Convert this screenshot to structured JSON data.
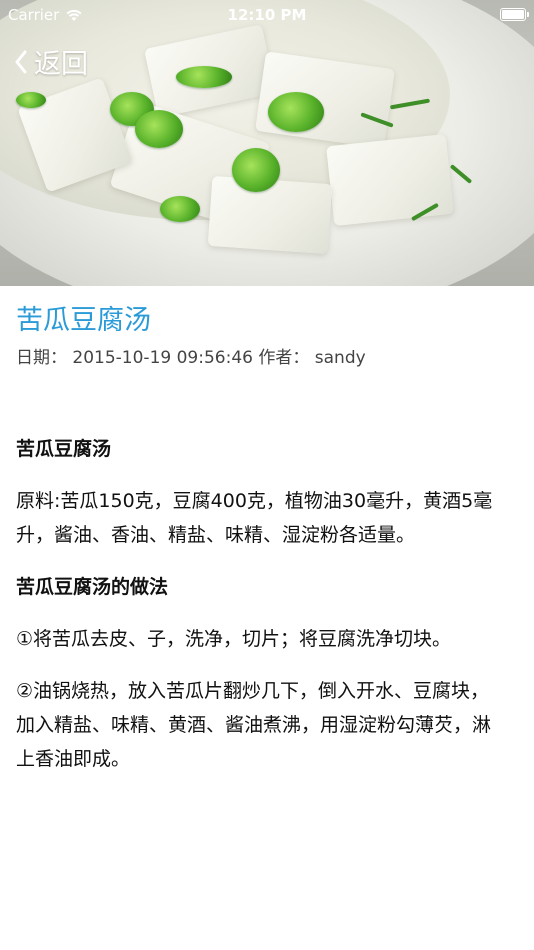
{
  "status_bar": {
    "carrier": "Carrier",
    "time": "12:10 PM"
  },
  "nav": {
    "back_label": "返回"
  },
  "article": {
    "title": "苦瓜豆腐汤",
    "date_label": "日期：",
    "date_value": "2015-10-19 09:56:46",
    "author_label": "作者：",
    "author_value": "sandy",
    "heading_1": "苦瓜豆腐汤",
    "ingredients": "原料:苦瓜150克，豆腐400克，植物油30毫升，黄酒5毫升，酱油、香油、精盐、味精、湿淀粉各适量。",
    "heading_2": "苦瓜豆腐汤的做法",
    "step_1": "①将苦瓜去皮、子，洗净，切片；将豆腐洗净切块。",
    "step_2": "②油锅烧热，放入苦瓜片翻炒几下，倒入开水、豆腐块，加入精盐、味精、黄酒、酱油煮沸，用湿淀粉勾薄芡，淋上香油即成。"
  },
  "colors": {
    "title": "#2a9bd7",
    "meta": "#444444",
    "body": "#111111"
  },
  "icons": {
    "status": [
      "wifi-icon",
      "battery-icon"
    ],
    "nav": [
      "chevron-left-icon"
    ]
  }
}
